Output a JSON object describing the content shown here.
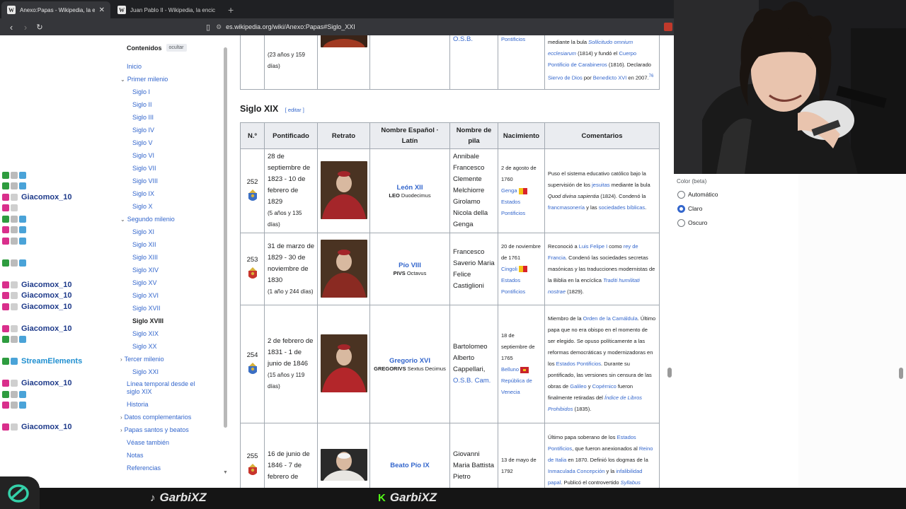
{
  "browser": {
    "tabs": [
      {
        "title": "Anexo:Papas - Wikipedia, la encic",
        "active": true
      },
      {
        "title": "Juan Pablo II - Wikipedia, la enciclop",
        "active": false
      }
    ],
    "url": "es.wikipedia.org/wiki/Anexo:Papas#Siglo_XXI"
  },
  "toc": {
    "title": "Contenidos",
    "hide": "ocultar",
    "items": [
      {
        "label": "Inicio",
        "level": 0
      },
      {
        "label": "Primer milenio",
        "level": 0,
        "chevron": true
      },
      {
        "label": "Siglo I",
        "level": 1
      },
      {
        "label": "Siglo II",
        "level": 1
      },
      {
        "label": "Siglo III",
        "level": 1
      },
      {
        "label": "Siglo IV",
        "level": 1
      },
      {
        "label": "Siglo V",
        "level": 1
      },
      {
        "label": "Siglo VI",
        "level": 1
      },
      {
        "label": "Siglo VII",
        "level": 1
      },
      {
        "label": "Siglo VIII",
        "level": 1
      },
      {
        "label": "Siglo IX",
        "level": 1
      },
      {
        "label": "Siglo X",
        "level": 1
      },
      {
        "label": "Segundo milenio",
        "level": 0,
        "chevron": true
      },
      {
        "label": "Siglo XI",
        "level": 1
      },
      {
        "label": "Siglo XII",
        "level": 1
      },
      {
        "label": "Siglo XIII",
        "level": 1
      },
      {
        "label": "Siglo XIV",
        "level": 1
      },
      {
        "label": "Siglo XV",
        "level": 1
      },
      {
        "label": "Siglo XVI",
        "level": 1
      },
      {
        "label": "Siglo XVII",
        "level": 1
      },
      {
        "label": "Siglo XVIII",
        "level": 1,
        "active": true
      },
      {
        "label": "Siglo XIX",
        "level": 1
      },
      {
        "label": "Siglo XX",
        "level": 1
      },
      {
        "label": "Tercer milenio",
        "level": 0,
        "chevron": true
      },
      {
        "label": "Siglo XXI",
        "level": 1
      },
      {
        "label": "Línea temporal desde el siglo XIX",
        "level": 0,
        "two": true
      },
      {
        "label": "Historia",
        "level": 0
      },
      {
        "label": "Datos complementarios",
        "level": 0,
        "chevron": true
      },
      {
        "label": "Papas santos y beatos",
        "level": 0,
        "chevron": true
      },
      {
        "label": "Véase también",
        "level": 0
      },
      {
        "label": "Notas",
        "level": 0
      },
      {
        "label": "Referencias",
        "level": 0
      }
    ]
  },
  "top_row": {
    "pontificado_tail": "(23 años y 159 días)",
    "nombre_de_pila_tail": "O.S.B.",
    "nacimiento_tail": "Pontificios",
    "comentarios": [
      {
        "t": "mediante la bula ",
        "l": false
      },
      {
        "t": "Sollicitudo omnium ecclesiarum",
        "l": true,
        "i": true
      },
      {
        "t": " (1814) y fundó el ",
        "l": false
      },
      {
        "t": "Cuerpo Pontificio de Carabineros",
        "l": true
      },
      {
        "t": " (1816). Declarado ",
        "l": false
      },
      {
        "t": "Siervo de Dios",
        "l": true
      },
      {
        "t": " por ",
        "l": false
      },
      {
        "t": "Benedicto XVI",
        "l": true
      },
      {
        "t": " en 2007.",
        "l": false
      },
      {
        "t": "76",
        "l": true,
        "sup": true
      }
    ]
  },
  "section": {
    "title": "Siglo XIX",
    "edit": "editar"
  },
  "table": {
    "headers": [
      "N.º",
      "Pontificado",
      "Retrato",
      "Nombre Español · Latín",
      "Nombre de pila",
      "Nacimiento",
      "Comentarios"
    ],
    "rows": [
      {
        "num": "252",
        "pontificado": "28 de septiembre de 1823 - 10 de febrero de 1829",
        "duracion": "(5 años y 135 días)",
        "nombre_es": "León XII",
        "nombre_lat_sc": "LEO",
        "nombre_lat": " Duodecimus",
        "pila": [
          {
            "t": "Annibale Francesco Clemente Melchiorre Girolamo Nicola della Genga",
            "l": false
          }
        ],
        "nac": [
          {
            "t": "2 de agosto de 1760",
            "l": false
          },
          {
            "t": "Genga",
            "l": true,
            "flag": "papal"
          },
          {
            "t": "Estados Pontificios",
            "l": true
          }
        ],
        "comentarios": [
          {
            "t": "Puso el sistema educativo católico bajo la supervisión de los ",
            "l": false
          },
          {
            "t": "jesuitas",
            "l": true
          },
          {
            "t": " mediante la bula ",
            "l": false
          },
          {
            "t": "Quod divina sapientia",
            "l": false,
            "i": true
          },
          {
            "t": " (1824). Condenó la ",
            "l": false
          },
          {
            "t": "francmasonería",
            "l": true
          },
          {
            "t": " y las ",
            "l": false
          },
          {
            "t": "sociedades bíblicas",
            "l": true
          },
          {
            "t": ".",
            "l": false
          }
        ],
        "robe": "#a5262a"
      },
      {
        "num": "253",
        "pontificado": "31 de marzo de 1829 - 30 de noviembre de 1830",
        "duracion": "(1 año y 244 días)",
        "nombre_es": "Pío VIII",
        "nombre_lat_sc": "PIVS",
        "nombre_lat": " Octavus",
        "pila": [
          {
            "t": "Francesco Saverio Maria Felice Castiglioni",
            "l": false
          }
        ],
        "nac": [
          {
            "t": "20 de noviembre de 1761",
            "l": false
          },
          {
            "t": "Cingoli",
            "l": true,
            "flag": "papal"
          },
          {
            "t": "Estados Pontificios",
            "l": true
          }
        ],
        "comentarios": [
          {
            "t": "Reconoció a ",
            "l": false
          },
          {
            "t": "Luis Felipe I",
            "l": true
          },
          {
            "t": " como ",
            "l": false
          },
          {
            "t": "rey de Francia",
            "l": true
          },
          {
            "t": ". Condenó las sociedades secretas masónicas y las traducciones modernistas de la Biblia en la encíclica ",
            "l": false
          },
          {
            "t": "Traditi humilitati nostrae",
            "l": true,
            "i": true
          },
          {
            "t": " (1829).",
            "l": false
          }
        ],
        "robe": "#8a2a22"
      },
      {
        "num": "254",
        "pontificado": "2 de febrero de 1831 - 1 de junio de 1846",
        "duracion": "(15 años y 119 días)",
        "nombre_es": "Gregorio XVI",
        "nombre_lat_sc": "GREGORIVS",
        "nombre_lat": " Sextus Decimus",
        "pila": [
          {
            "t": "Bartolomeo Alberto Cappellari, ",
            "l": false
          },
          {
            "t": "O.S.B. Cam.",
            "l": true
          }
        ],
        "nac": [
          {
            "t": "18 de septiembre de 1765",
            "l": false
          },
          {
            "t": "Belluno",
            "l": true,
            "flag": "venice"
          },
          {
            "t": "República de Venecia",
            "l": true
          }
        ],
        "comentarios": [
          {
            "t": "Miembro de la ",
            "l": false
          },
          {
            "t": "Orden de la Camáldula",
            "l": true
          },
          {
            "t": ". Último papa que no era obispo en el momento de ser elegido. Se opuso políticamente a las reformas democráticas y modernizadoras en los ",
            "l": false
          },
          {
            "t": "Estados Pontificios",
            "l": true
          },
          {
            "t": ". Durante su pontificado, las versiones sin censura de las obras de ",
            "l": false
          },
          {
            "t": "Galileo",
            "l": true
          },
          {
            "t": " y ",
            "l": false
          },
          {
            "t": "Copérnico",
            "l": true
          },
          {
            "t": " fueron finalmente retiradas del ",
            "l": false
          },
          {
            "t": "Índice de Libros Prohibidos",
            "l": true,
            "i": true
          },
          {
            "t": " (1835).",
            "l": false
          }
        ],
        "robe": "#b3262a"
      },
      {
        "num": "255",
        "pontificado": "16 de junio de 1846 - 7 de febrero de",
        "duracion": "",
        "nombre_es": "Beato Pío IX",
        "nombre_lat_sc": "",
        "nombre_lat": "",
        "pila": [
          {
            "t": "Giovanni Maria Battista Pietro",
            "l": false
          }
        ],
        "nac": [
          {
            "t": "13 de mayo de 1792",
            "l": false
          }
        ],
        "comentarios": [
          {
            "t": "Último papa soberano de los ",
            "l": false
          },
          {
            "t": "Estados Pontificios",
            "l": true
          },
          {
            "t": ", que fueron anexionados al ",
            "l": false
          },
          {
            "t": "Reino de Italia",
            "l": true
          },
          {
            "t": " en 1870. Definió los dogmas de la ",
            "l": false
          },
          {
            "t": "Inmaculada Concepción",
            "l": true
          },
          {
            "t": " y la ",
            "l": false
          },
          {
            "t": "infalibilidad papal",
            "l": true
          },
          {
            "t": ". Publicó el controvertido ",
            "l": false
          },
          {
            "t": "Syllabus",
            "l": true,
            "i": true
          },
          {
            "t": " (1864).",
            "l": false
          }
        ],
        "robe": "#e8e6e2"
      }
    ]
  },
  "appearance": {
    "heading": "Color (beta)",
    "options": [
      {
        "label": "Automático",
        "selected": false
      },
      {
        "label": "Claro",
        "selected": true
      },
      {
        "label": "Oscuro",
        "selected": false
      }
    ]
  },
  "chat": [
    {
      "name": "",
      "color": "#3a3a3a",
      "badges": [
        "#2e9c3f",
        "#bbbbbb",
        "#4aa3d8"
      ]
    },
    {
      "name": "",
      "color": "#3a3a3a",
      "badges": [
        "#2e9c3f",
        "#bbbbbb",
        "#4aa3d8"
      ]
    },
    {
      "name": "Giacomox_10",
      "color": "#1e3a8a",
      "badges": [
        "#d92f8c",
        "#cfcfcf"
      ]
    },
    {
      "name": "",
      "color": "#3a3a3a",
      "badges": [
        "#d92f8c",
        "#cfcfcf"
      ]
    },
    {
      "name": "",
      "color": "#3a3a3a",
      "badges": [
        "#2e9c3f",
        "#bbbbbb",
        "#4aa3d8"
      ]
    },
    {
      "name": "",
      "color": "#3a3a3a",
      "badges": [
        "#d92f8c",
        "#bbbbbb",
        "#4aa3d8"
      ]
    },
    {
      "name": "",
      "color": "#3a3a3a",
      "badges": [
        "#d92f8c",
        "#bbbbbb",
        "#4aa3d8"
      ]
    },
    {
      "name": "",
      "color": "#3a3a3a",
      "badges": []
    },
    {
      "name": "",
      "color": "#3a3a3a",
      "badges": [
        "#2e9c3f",
        "#bbbbbb",
        "#4aa3d8"
      ]
    },
    {
      "name": "",
      "color": "#3a3a3a",
      "badges": []
    },
    {
      "name": "Giacomox_10",
      "color": "#1e3a8a",
      "badges": [
        "#d92f8c",
        "#cfcfcf"
      ]
    },
    {
      "name": "Giacomox_10",
      "color": "#1e3a8a",
      "badges": [
        "#d92f8c",
        "#cfcfcf"
      ]
    },
    {
      "name": "Giacomox_10",
      "color": "#1e3a8a",
      "badges": [
        "#d92f8c",
        "#cfcfcf"
      ]
    },
    {
      "name": "",
      "color": "#3a3a3a",
      "badges": []
    },
    {
      "name": "Giacomox_10",
      "color": "#1e3a8a",
      "badges": [
        "#d92f8c",
        "#cfcfcf"
      ]
    },
    {
      "name": "",
      "color": "#3a3a3a",
      "badges": [
        "#2e9c3f",
        "#bbbbbb",
        "#4aa3d8"
      ]
    },
    {
      "name": "",
      "color": "#3a3a3a",
      "badges": []
    },
    {
      "name": "StreamElements",
      "color": "#1f8fd0",
      "badges": [
        "#2e9c3f",
        "#4aa3d8"
      ]
    },
    {
      "name": "",
      "color": "#3a3a3a",
      "badges": []
    },
    {
      "name": "Giacomox_10",
      "color": "#1e3a8a",
      "badges": [
        "#d92f8c",
        "#cfcfcf"
      ]
    },
    {
      "name": "",
      "color": "#3a3a3a",
      "badges": [
        "#2e9c3f",
        "#bbbbbb",
        "#4aa3d8"
      ]
    },
    {
      "name": "",
      "color": "#3a3a3a",
      "badges": [
        "#d92f8c",
        "#bbbbbb",
        "#4aa3d8"
      ]
    },
    {
      "name": "",
      "color": "#3a3a3a",
      "badges": []
    },
    {
      "name": "Giacomox_10",
      "color": "#1e3a8a",
      "badges": [
        "#d92f8c",
        "#cfcfcf"
      ]
    }
  ],
  "stream": {
    "handles": [
      {
        "icon": "tiktok-icon",
        "glyph": "♪",
        "label": "GarbiXZ"
      },
      {
        "icon": "kick-icon",
        "glyph": "K",
        "label": "GarbiXZ"
      }
    ],
    "colors": {
      "handle_icon_tiktok": "#e6e6e6",
      "handle_icon_kick": "#53fc18"
    }
  }
}
